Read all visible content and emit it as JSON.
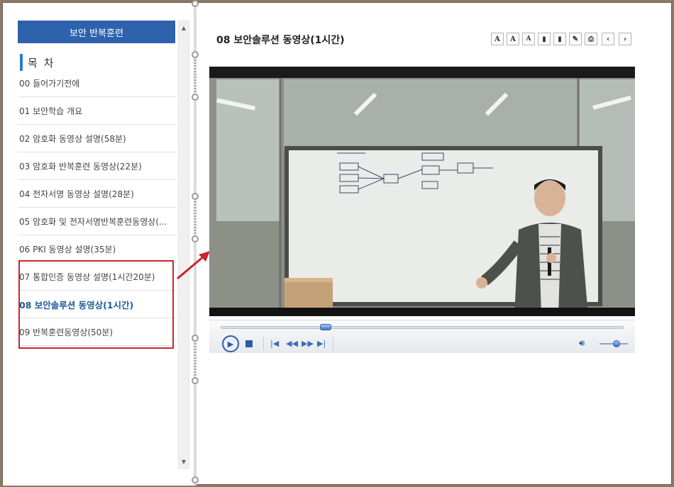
{
  "sidebar": {
    "book_title": "보안 반복훈련",
    "toc_heading": "목 차",
    "items": [
      {
        "label": "00 들어가기전에"
      },
      {
        "label": "01 보안학습 개요"
      },
      {
        "label": "02 암호화 동영상 설명(58분)"
      },
      {
        "label": "03 암호화 반복훈련 동영상(22분)"
      },
      {
        "label": "04 전자서명 동영상 설명(28분)"
      },
      {
        "label": "05 암호화 및 전자서명반복훈련동영상(..."
      },
      {
        "label": "06 PKI 동영상 설명(35분)"
      },
      {
        "label": "07 통합인증 동영상 설명(1시간20분)"
      },
      {
        "label": "08 보안솔루션 동영상(1시간)",
        "active": true
      },
      {
        "label": "09 반복훈련동영상(50분)"
      }
    ]
  },
  "main": {
    "lesson_title": "08 보안솔루션 동영상(1시간)",
    "toolbar": [
      {
        "glyph": "A",
        "icon": "font-size-icon"
      },
      {
        "glyph": "A",
        "icon": "font-larger-icon"
      },
      {
        "glyph": "A",
        "icon": "font-smaller-icon"
      },
      {
        "glyph": "▮",
        "icon": "bookmark-icon"
      },
      {
        "glyph": "▮",
        "icon": "bookmark-list-icon"
      },
      {
        "glyph": "✎",
        "icon": "memo-icon"
      },
      {
        "glyph": "⎙",
        "icon": "print-icon"
      },
      {
        "glyph": "‹",
        "icon": "prev-page-icon"
      },
      {
        "glyph": "›",
        "icon": "next-page-icon"
      }
    ]
  },
  "player": {
    "progress": 0.26,
    "volume": 0.6,
    "icons": [
      "play-icon",
      "stop-icon",
      "skip-back-icon",
      "rewind-icon",
      "fast-forward-icon",
      "skip-forward-icon",
      "volume-icon"
    ]
  },
  "colors": {
    "accent_blue": "#2f62ad",
    "highlight_red": "#c8262d",
    "active_item": "#1f5a9a"
  }
}
